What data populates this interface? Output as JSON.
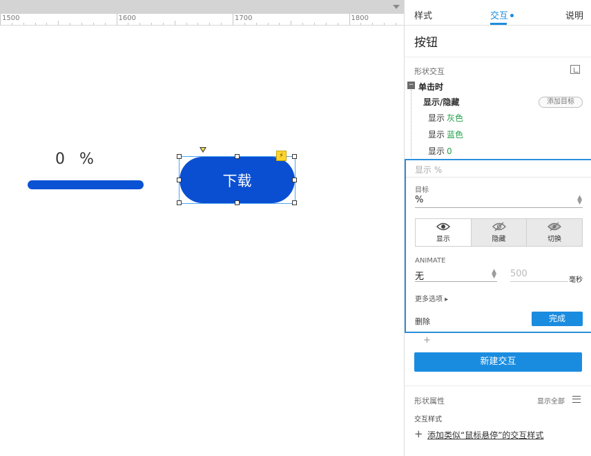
{
  "canvas": {
    "ruler_labels": [
      "1500",
      "1600",
      "1700",
      "1800"
    ],
    "percent_value": "0",
    "percent_sign": "%",
    "progress_fraction": 1.0,
    "download_label": "下载",
    "lightning_glyph": "⚡"
  },
  "panel": {
    "tabs": {
      "style": "样式",
      "interactions": "交互",
      "notes": "说明"
    },
    "widget_title": "按钮",
    "section_title": "形状交互",
    "event": {
      "collapse_glyph": "−",
      "label": "单击时"
    },
    "action": {
      "label": "显示/隐藏",
      "add_target": "添加目标"
    },
    "targets": [
      {
        "verb": "显示",
        "name": "灰色"
      },
      {
        "verb": "显示",
        "name": "蓝色"
      },
      {
        "verb": "显示",
        "name": "0"
      }
    ],
    "editor": {
      "header": "显示 %",
      "target_label": "目标",
      "target_value": "%",
      "visibility": {
        "show": "显示",
        "hide": "隐藏",
        "toggle": "切换"
      },
      "animate_label": "ANIMATE",
      "animate_value": "无",
      "duration_value": "500",
      "duration_unit": "毫秒",
      "more_options": "更多选项 ▸",
      "delete": "删除",
      "done": "完成"
    },
    "add_plus": "+",
    "new_interaction": "新建交互",
    "shape_props": "形状属性",
    "show_all": "显示全部",
    "interaction_styles": "交互样式",
    "add_style_plus": "+",
    "add_style_link": "添加类似“鼠标悬停”的交互样式"
  },
  "colors": {
    "accent": "#1a8ce0",
    "button_blue": "#0a4fd2",
    "target_green": "#25a04a"
  }
}
